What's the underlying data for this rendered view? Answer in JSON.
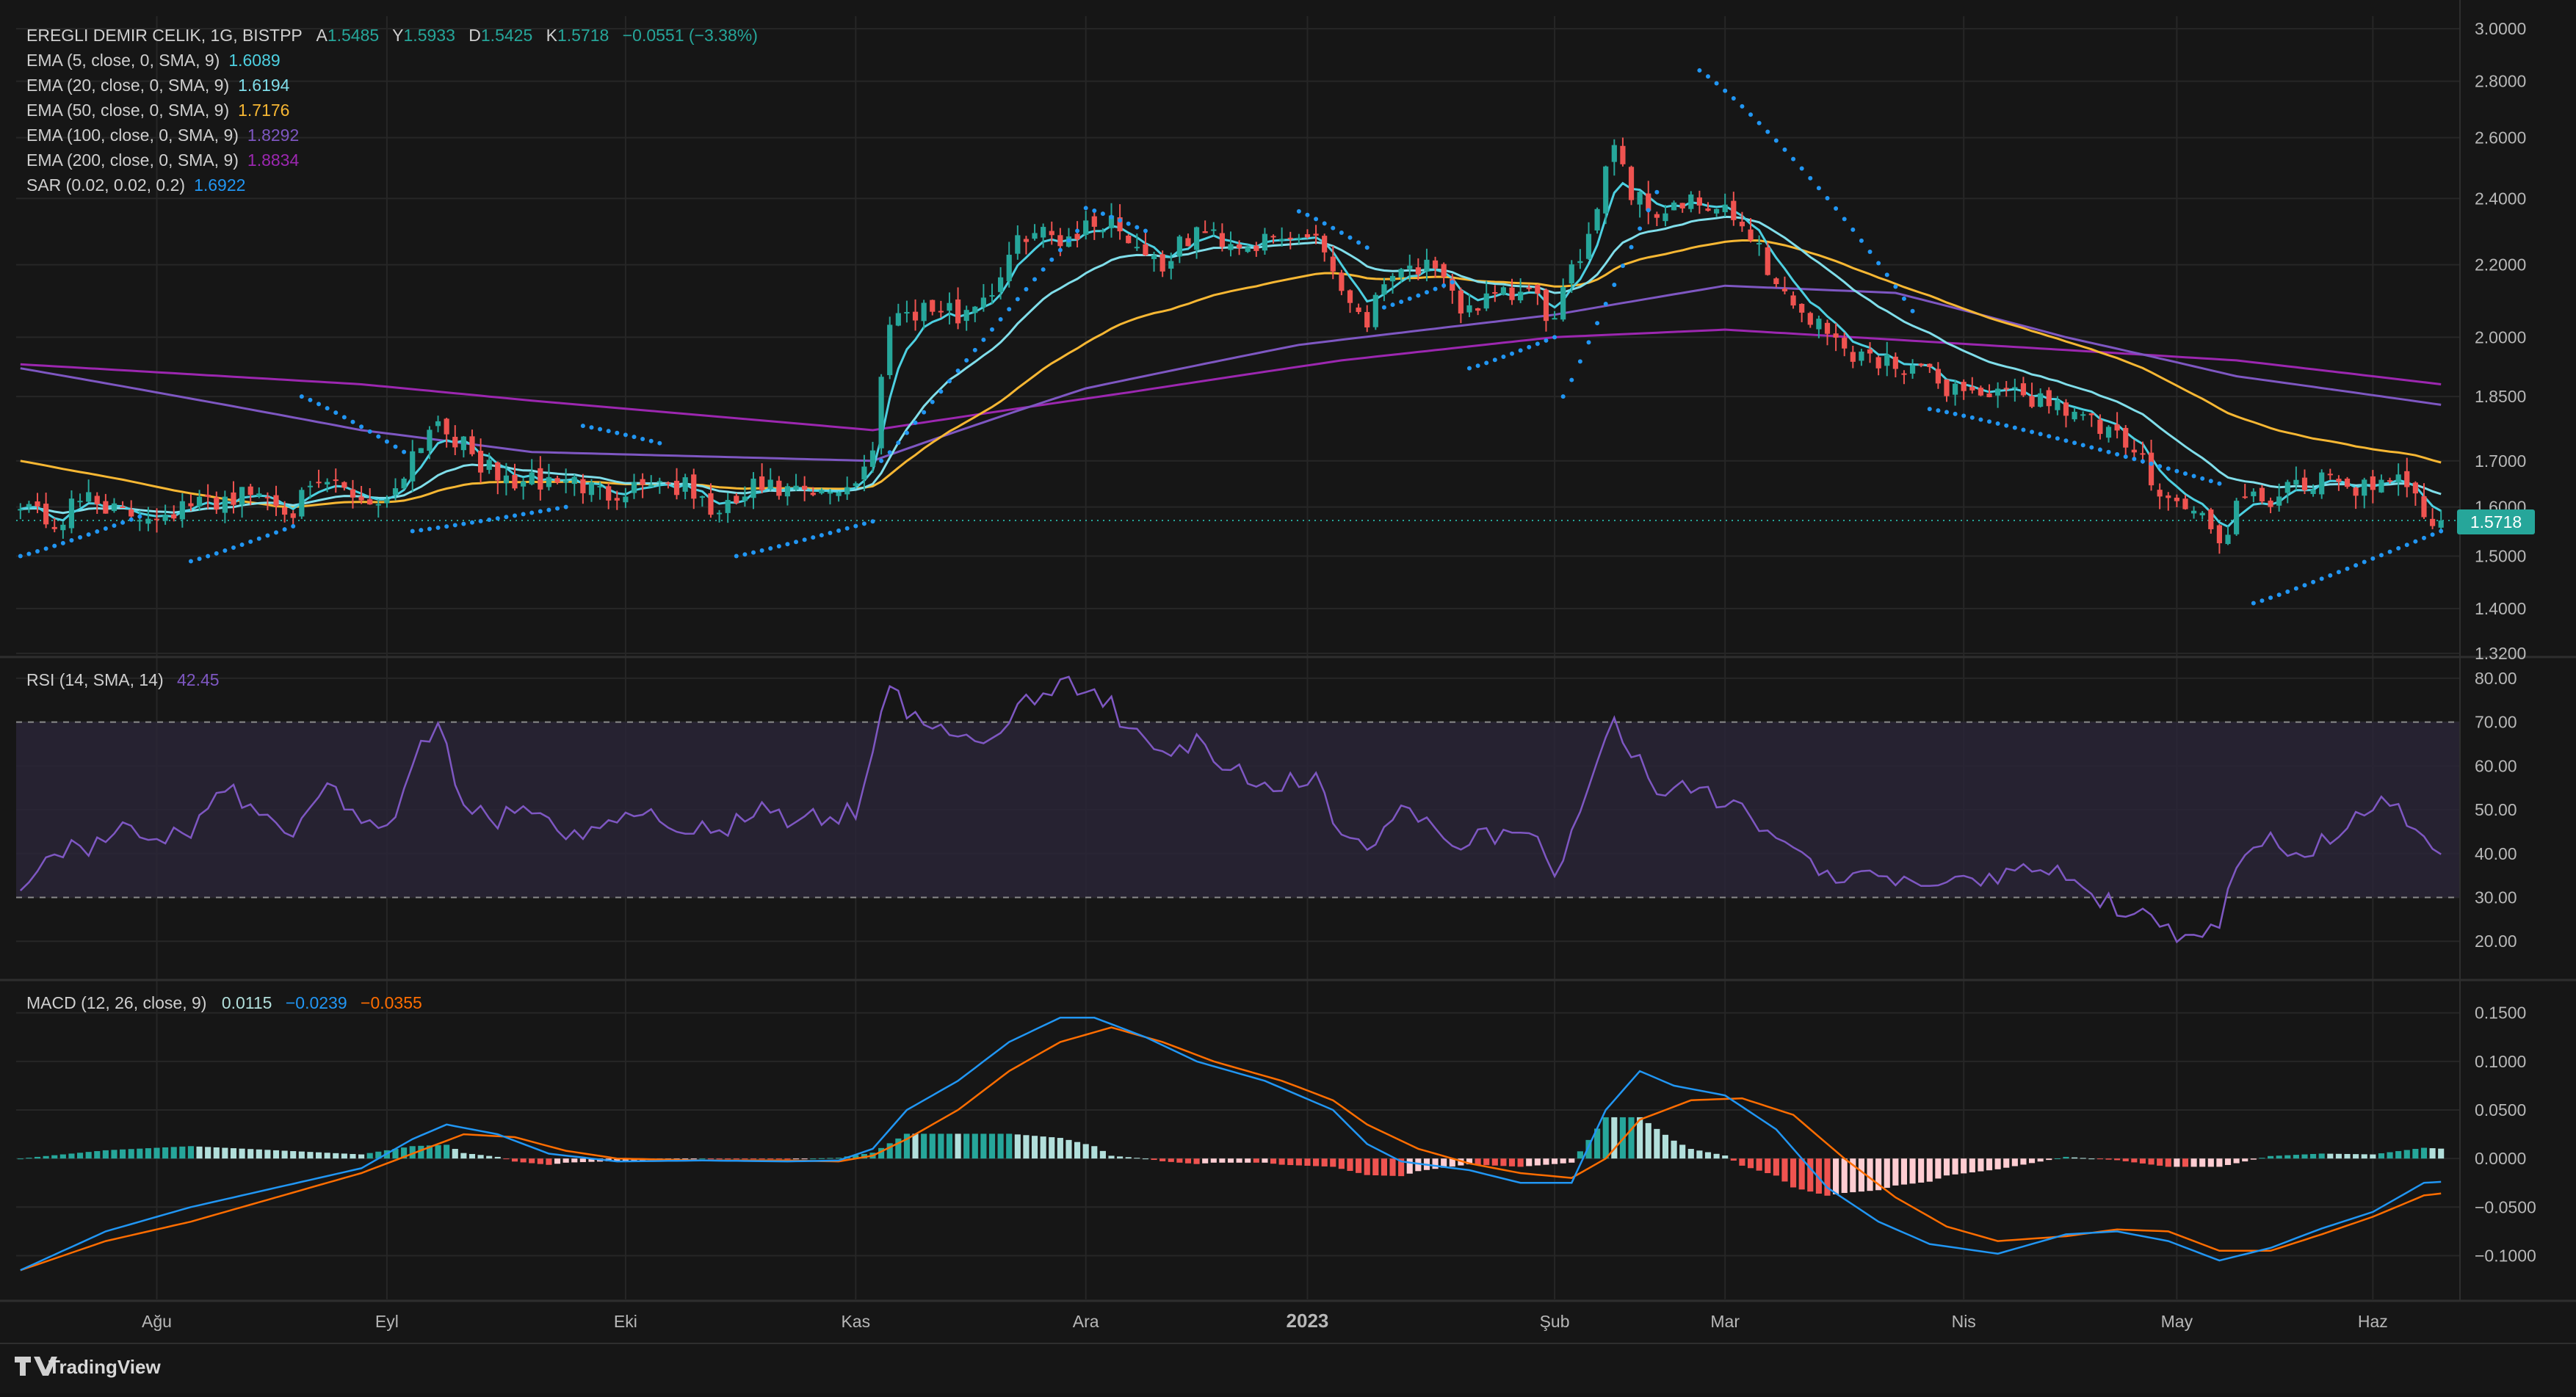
{
  "colors": {
    "bg": "#161616",
    "grid": "#262626",
    "text": "#cfcfcf",
    "axisText": "#b8b8b8",
    "up": "#26a69a",
    "down": "#ef5350",
    "upLight": "#b2dfdb",
    "downLight": "#ffcdd2",
    "ema5": "#4dd0e1",
    "ema20": "#80deea",
    "ema50": "#f7b733",
    "ema100": "#7e57c2",
    "ema200": "#9c27b0",
    "sar": "#2196f3",
    "rsi": "#7e57c2",
    "rsiBand": "#2a2538",
    "macd": "#2196f3",
    "signal": "#ff6d00",
    "badge": "#26a69a"
  },
  "legend": {
    "symbol": "EREGLI DEMIR CELIK, 1G, BISTPP",
    "a_label": "A",
    "a_value": "1.5485",
    "y_label": "Y",
    "y_value": "1.5933",
    "d_label": "D",
    "d_value": "1.5425",
    "k_label": "K",
    "k_value": "1.5718",
    "change": "−0.0551 (−3.38%)",
    "studies": [
      {
        "label": "EMA (5, close, 0, SMA, 9)",
        "value": "1.6089",
        "color": "#4dd0e1"
      },
      {
        "label": "EMA (20, close, 0, SMA, 9)",
        "value": "1.6194",
        "color": "#80deea"
      },
      {
        "label": "EMA (50, close, 0, SMA, 9)",
        "value": "1.7176",
        "color": "#f7b733"
      },
      {
        "label": "EMA (100, close, 0, SMA, 9)",
        "value": "1.8292",
        "color": "#7e57c2"
      },
      {
        "label": "EMA (200, close, 0, SMA, 9)",
        "value": "1.8834",
        "color": "#9c27b0"
      },
      {
        "label": "SAR (0.02, 0.02, 0.2)",
        "value": "1.6922",
        "color": "#2196f3"
      }
    ]
  },
  "rsi_legend": {
    "label": "RSI (14, SMA, 14)",
    "value": "42.45"
  },
  "macd_legend": {
    "label": "MACD (12, 26, close, 9)",
    "hist": "0.0115",
    "macd": "−0.0239",
    "signal": "−0.0355"
  },
  "price_badge": "1.5718",
  "watermark": "TradingView",
  "chart_data": [
    {
      "type": "candlestick",
      "title": "EREGLI DEMIR CELIK, 1G, BISTPP",
      "ylim": [
        1.32,
        3.05
      ],
      "scale": "log",
      "yticks": [
        "3.0000",
        "2.8000",
        "2.6000",
        "2.4000",
        "2.2000",
        "2.0000",
        "1.8500",
        "1.7000",
        "1.6000",
        "1.5000",
        "1.4000",
        "1.3200"
      ],
      "ytick_values": [
        3.0,
        2.8,
        2.6,
        2.4,
        2.2,
        2.0,
        1.85,
        1.7,
        1.6,
        1.5,
        1.4,
        1.32
      ],
      "x_labels": [
        "Ağu",
        "Eyl",
        "Eki",
        "Kas",
        "Ara",
        "2023",
        "Şub",
        "Mar",
        "Nis",
        "May",
        "Haz"
      ],
      "x_label_index": [
        16,
        43,
        71,
        98,
        125,
        151,
        180,
        200,
        228,
        253,
        276
      ],
      "close_anchors": [
        [
          0,
          1.62
        ],
        [
          4,
          1.56
        ],
        [
          8,
          1.63
        ],
        [
          12,
          1.58
        ],
        [
          16,
          1.59
        ],
        [
          20,
          1.6
        ],
        [
          24,
          1.62
        ],
        [
          28,
          1.63
        ],
        [
          32,
          1.6
        ],
        [
          36,
          1.65
        ],
        [
          40,
          1.62
        ],
        [
          43,
          1.61
        ],
        [
          46,
          1.72
        ],
        [
          49,
          1.8
        ],
        [
          52,
          1.73
        ],
        [
          56,
          1.66
        ],
        [
          60,
          1.65
        ],
        [
          64,
          1.66
        ],
        [
          68,
          1.63
        ],
        [
          71,
          1.64
        ],
        [
          74,
          1.66
        ],
        [
          78,
          1.64
        ],
        [
          82,
          1.58
        ],
        [
          86,
          1.64
        ],
        [
          90,
          1.63
        ],
        [
          94,
          1.62
        ],
        [
          98,
          1.66
        ],
        [
          100,
          1.72
        ],
        [
          102,
          2.06
        ],
        [
          106,
          2.08
        ],
        [
          110,
          2.06
        ],
        [
          114,
          2.13
        ],
        [
          118,
          2.3
        ],
        [
          122,
          2.28
        ],
        [
          125,
          2.31
        ],
        [
          128,
          2.34
        ],
        [
          130,
          2.28
        ],
        [
          134,
          2.2
        ],
        [
          138,
          2.3
        ],
        [
          142,
          2.27
        ],
        [
          146,
          2.26
        ],
        [
          150,
          2.28
        ],
        [
          152,
          2.3
        ],
        [
          155,
          2.13
        ],
        [
          158,
          2.05
        ],
        [
          161,
          2.2
        ],
        [
          165,
          2.19
        ],
        [
          169,
          2.08
        ],
        [
          173,
          2.1
        ],
        [
          177,
          2.12
        ],
        [
          180,
          2.04
        ],
        [
          184,
          2.3
        ],
        [
          187,
          2.6
        ],
        [
          189,
          2.42
        ],
        [
          192,
          2.36
        ],
        [
          196,
          2.38
        ],
        [
          200,
          2.35
        ],
        [
          203,
          2.3
        ],
        [
          206,
          2.14
        ],
        [
          210,
          2.05
        ],
        [
          214,
          1.97
        ],
        [
          218,
          1.94
        ],
        [
          222,
          1.93
        ],
        [
          225,
          1.88
        ],
        [
          228,
          1.87
        ],
        [
          232,
          1.85
        ],
        [
          236,
          1.85
        ],
        [
          240,
          1.83
        ],
        [
          244,
          1.77
        ],
        [
          248,
          1.72
        ],
        [
          252,
          1.62
        ],
        [
          256,
          1.58
        ],
        [
          258,
          1.52
        ],
        [
          260,
          1.6
        ],
        [
          264,
          1.62
        ],
        [
          268,
          1.64
        ],
        [
          272,
          1.66
        ],
        [
          276,
          1.63
        ],
        [
          280,
          1.66
        ],
        [
          283,
          1.57
        ]
      ],
      "ema200_anchors": [
        [
          0,
          1.93
        ],
        [
          40,
          1.88
        ],
        [
          60,
          1.84
        ],
        [
          100,
          1.77
        ],
        [
          130,
          1.86
        ],
        [
          155,
          1.94
        ],
        [
          180,
          2.0
        ],
        [
          200,
          2.02
        ],
        [
          230,
          1.98
        ],
        [
          260,
          1.94
        ],
        [
          284,
          1.88
        ]
      ],
      "ema100_anchors": [
        [
          0,
          1.92
        ],
        [
          40,
          1.77
        ],
        [
          60,
          1.72
        ],
        [
          100,
          1.7
        ],
        [
          125,
          1.87
        ],
        [
          150,
          1.98
        ],
        [
          180,
          2.06
        ],
        [
          200,
          2.14
        ],
        [
          220,
          2.12
        ],
        [
          240,
          2.0
        ],
        [
          260,
          1.9
        ],
        [
          284,
          1.83
        ]
      ],
      "sar_ranges": [
        [
          0,
          14,
          1.5,
          1.58
        ],
        [
          20,
          32,
          1.49,
          1.56
        ],
        [
          33,
          45,
          1.85,
          1.72
        ],
        [
          46,
          64,
          1.55,
          1.6
        ],
        [
          66,
          75,
          1.78,
          1.74
        ],
        [
          84,
          100,
          1.5,
          1.57
        ],
        [
          101,
          124,
          1.7,
          2.3
        ],
        [
          125,
          132,
          2.37,
          2.3
        ],
        [
          150,
          158,
          2.36,
          2.25
        ],
        [
          160,
          168,
          2.08,
          2.15
        ],
        [
          170,
          180,
          1.92,
          2.0
        ],
        [
          181,
          192,
          1.85,
          2.42
        ],
        [
          197,
          222,
          2.84,
          2.07
        ],
        [
          224,
          258,
          1.82,
          1.65
        ],
        [
          262,
          284,
          1.41,
          1.55
        ]
      ]
    },
    {
      "type": "line",
      "title": "RSI (14, SMA, 14)",
      "ylim": [
        12,
        84
      ],
      "yticks": [
        "80.00",
        "70.00",
        "60.00",
        "50.00",
        "40.00",
        "30.00",
        "20.00"
      ],
      "ytick_values": [
        80,
        70,
        60,
        50,
        40,
        30,
        20
      ],
      "band": [
        30,
        70
      ],
      "anchors": [
        [
          0,
          30
        ],
        [
          4,
          42
        ],
        [
          8,
          40
        ],
        [
          12,
          45
        ],
        [
          16,
          43
        ],
        [
          20,
          46
        ],
        [
          24,
          55
        ],
        [
          28,
          48
        ],
        [
          32,
          45
        ],
        [
          36,
          55
        ],
        [
          40,
          48
        ],
        [
          43,
          44
        ],
        [
          46,
          60
        ],
        [
          49,
          70
        ],
        [
          52,
          50
        ],
        [
          56,
          48
        ],
        [
          60,
          49
        ],
        [
          64,
          43
        ],
        [
          68,
          47
        ],
        [
          71,
          50
        ],
        [
          74,
          48
        ],
        [
          78,
          47
        ],
        [
          82,
          45
        ],
        [
          86,
          50
        ],
        [
          90,
          48
        ],
        [
          94,
          48
        ],
        [
          98,
          50
        ],
        [
          100,
          62
        ],
        [
          102,
          78
        ],
        [
          106,
          68
        ],
        [
          110,
          68
        ],
        [
          114,
          66
        ],
        [
          118,
          75
        ],
        [
          122,
          78
        ],
        [
          125,
          78
        ],
        [
          128,
          74
        ],
        [
          130,
          68
        ],
        [
          134,
          62
        ],
        [
          138,
          65
        ],
        [
          142,
          60
        ],
        [
          146,
          56
        ],
        [
          150,
          56
        ],
        [
          152,
          58
        ],
        [
          155,
          45
        ],
        [
          158,
          40
        ],
        [
          161,
          50
        ],
        [
          165,
          48
        ],
        [
          169,
          42
        ],
        [
          173,
          44
        ],
        [
          177,
          46
        ],
        [
          180,
          35
        ],
        [
          184,
          55
        ],
        [
          187,
          72
        ],
        [
          189,
          62
        ],
        [
          192,
          56
        ],
        [
          196,
          54
        ],
        [
          200,
          52
        ],
        [
          203,
          48
        ],
        [
          206,
          42
        ],
        [
          210,
          38
        ],
        [
          214,
          35
        ],
        [
          218,
          34
        ],
        [
          222,
          33
        ],
        [
          225,
          32
        ],
        [
          228,
          34
        ],
        [
          232,
          33
        ],
        [
          236,
          38
        ],
        [
          240,
          34
        ],
        [
          244,
          30
        ],
        [
          248,
          26
        ],
        [
          252,
          22
        ],
        [
          256,
          19
        ],
        [
          258,
          25
        ],
        [
          260,
          36
        ],
        [
          264,
          43
        ],
        [
          268,
          40
        ],
        [
          272,
          45
        ],
        [
          276,
          52
        ],
        [
          280,
          48
        ],
        [
          283,
          42
        ]
      ]
    },
    {
      "type": "bar+line",
      "title": "MACD (12, 26, close, 9)",
      "ylim": [
        -0.145,
        0.18
      ],
      "yticks": [
        "0.1500",
        "0.1000",
        "0.0500",
        "0.0000",
        "−0.0500",
        "−0.1000"
      ],
      "ytick_values": [
        0.15,
        0.1,
        0.05,
        0.0,
        -0.05,
        -0.1
      ],
      "macd_anchors": [
        [
          0,
          -0.115
        ],
        [
          10,
          -0.075
        ],
        [
          20,
          -0.05
        ],
        [
          30,
          -0.03
        ],
        [
          40,
          -0.01
        ],
        [
          46,
          0.02
        ],
        [
          50,
          0.035
        ],
        [
          56,
          0.025
        ],
        [
          62,
          0.005
        ],
        [
          70,
          -0.003
        ],
        [
          80,
          -0.002
        ],
        [
          90,
          -0.003
        ],
        [
          96,
          -0.002
        ],
        [
          100,
          0.01
        ],
        [
          104,
          0.05
        ],
        [
          110,
          0.08
        ],
        [
          116,
          0.12
        ],
        [
          122,
          0.145
        ],
        [
          126,
          0.145
        ],
        [
          132,
          0.125
        ],
        [
          138,
          0.1
        ],
        [
          146,
          0.08
        ],
        [
          154,
          0.05
        ],
        [
          158,
          0.015
        ],
        [
          162,
          -0.003
        ],
        [
          170,
          -0.012
        ],
        [
          176,
          -0.025
        ],
        [
          182,
          -0.025
        ],
        [
          186,
          0.05
        ],
        [
          190,
          0.09
        ],
        [
          194,
          0.075
        ],
        [
          200,
          0.065
        ],
        [
          206,
          0.03
        ],
        [
          212,
          -0.03
        ],
        [
          218,
          -0.065
        ],
        [
          224,
          -0.088
        ],
        [
          232,
          -0.098
        ],
        [
          240,
          -0.078
        ],
        [
          246,
          -0.075
        ],
        [
          252,
          -0.085
        ],
        [
          258,
          -0.105
        ],
        [
          264,
          -0.092
        ],
        [
          270,
          -0.072
        ],
        [
          276,
          -0.055
        ],
        [
          282,
          -0.025
        ],
        [
          284,
          -0.024
        ]
      ],
      "signal_anchors": [
        [
          0,
          -0.115
        ],
        [
          10,
          -0.085
        ],
        [
          20,
          -0.065
        ],
        [
          30,
          -0.04
        ],
        [
          40,
          -0.015
        ],
        [
          46,
          0.005
        ],
        [
          52,
          0.025
        ],
        [
          58,
          0.022
        ],
        [
          64,
          0.008
        ],
        [
          70,
          0.0
        ],
        [
          80,
          -0.002
        ],
        [
          90,
          -0.002
        ],
        [
          96,
          -0.003
        ],
        [
          100,
          0.003
        ],
        [
          104,
          0.02
        ],
        [
          110,
          0.05
        ],
        [
          116,
          0.09
        ],
        [
          122,
          0.12
        ],
        [
          128,
          0.135
        ],
        [
          134,
          0.12
        ],
        [
          140,
          0.1
        ],
        [
          148,
          0.08
        ],
        [
          154,
          0.06
        ],
        [
          158,
          0.035
        ],
        [
          164,
          0.01
        ],
        [
          170,
          -0.005
        ],
        [
          176,
          -0.015
        ],
        [
          182,
          -0.02
        ],
        [
          186,
          0.0
        ],
        [
          190,
          0.04
        ],
        [
          196,
          0.06
        ],
        [
          202,
          0.062
        ],
        [
          208,
          0.045
        ],
        [
          214,
          0.0
        ],
        [
          220,
          -0.04
        ],
        [
          226,
          -0.07
        ],
        [
          232,
          -0.085
        ],
        [
          240,
          -0.08
        ],
        [
          246,
          -0.073
        ],
        [
          252,
          -0.075
        ],
        [
          258,
          -0.095
        ],
        [
          264,
          -0.095
        ],
        [
          270,
          -0.078
        ],
        [
          276,
          -0.06
        ],
        [
          282,
          -0.038
        ],
        [
          284,
          -0.036
        ]
      ]
    }
  ]
}
